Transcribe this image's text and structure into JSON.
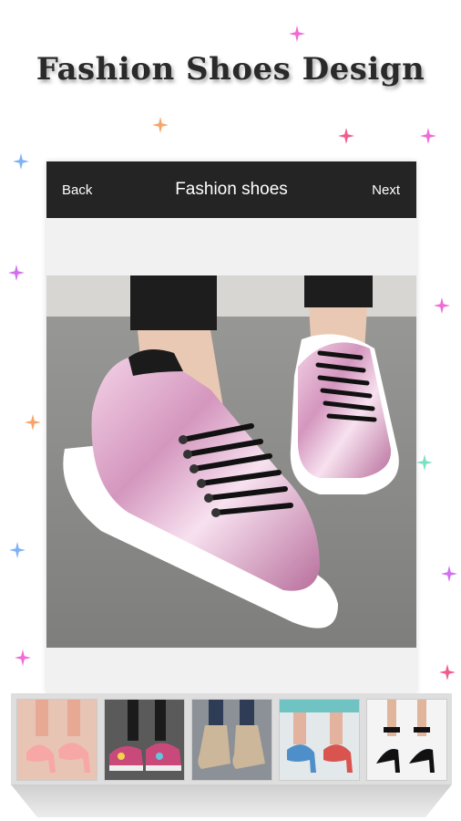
{
  "headline": "Fashion Shoes Design",
  "app_bar": {
    "back_label": "Back",
    "title": "Fashion shoes",
    "next_label": "Next"
  },
  "main_image": {
    "label": "pink metallic sneakers"
  },
  "thumbnails": [
    {
      "label": "pink high heels"
    },
    {
      "label": "floral sneakers"
    },
    {
      "label": "beige ankle boots"
    },
    {
      "label": "floral pumps"
    },
    {
      "label": "black ankle strap heels"
    }
  ],
  "colors": {
    "bar": "#242424",
    "sparkle_pink": "#f06bd6",
    "sparkle_orange": "#f7a46b",
    "sparkle_blue": "#7fb2f5"
  }
}
